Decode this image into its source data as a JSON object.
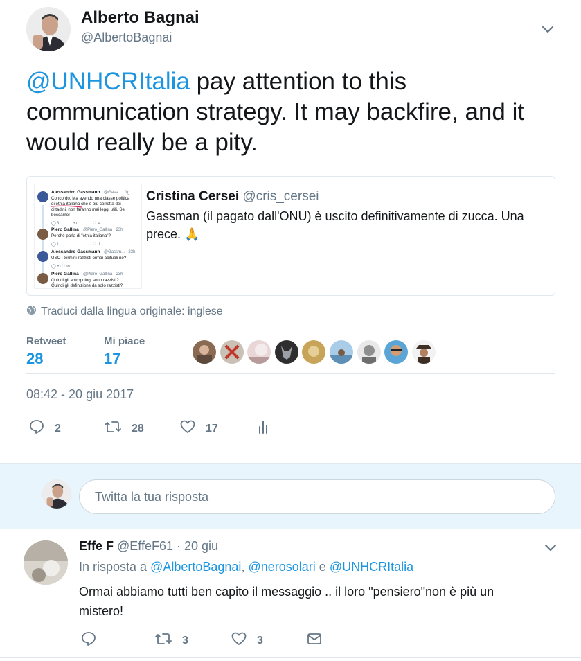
{
  "tweet": {
    "author_name": "Alberto Bagnai",
    "author_handle": "@AlbertoBagnai",
    "mention": "@UNHCRItalia",
    "text": " pay attention to this communication strategy. It may backfire, and it would really be a pity.",
    "menu_icon": "chevron-down-icon"
  },
  "quoted": {
    "name": "Cristina Cersei",
    "handle": "@cris_cersei",
    "text": "Gassman (il pagato dall'ONU) è uscito definitivamente di zucca. Una prece. 🙏",
    "thumbnail": {
      "rows": [
        {
          "name": "Alessandro Gassmann",
          "meta": "@Gass... · 1g",
          "lines": [
            "Concordo. Ma avendo una classe politica",
            "di etnia italiana che è più corrotta dei",
            "cittadini, non faranno mai leggi utili. Se",
            "beccamo!"
          ]
        },
        {
          "name": "Piero Gallina",
          "meta": "@Piero_Gallina · 23h",
          "lines": [
            "Perché parla di \"etnia italiana\"?"
          ]
        },
        {
          "name": "Alessandro Gassmann",
          "meta": "@Gassm... · 23h",
          "lines": [
            "USO i termini razzisti ormai abituali no?"
          ]
        },
        {
          "name": "Piero Gallina",
          "meta": "@Piero_Gallina · 23h",
          "lines": [
            "Quindi gli antropologi sono razzisti?",
            "Quindi gli definizione da solo razzisti?"
          ]
        }
      ],
      "counts": [
        "3",
        "4",
        "1",
        "1"
      ]
    }
  },
  "translate_label": "Traduci dalla lingua originale: inglese",
  "stats": {
    "retweet_label": "Retweet",
    "retweet_count": "28",
    "likes_label": "Mi piace",
    "likes_count": "17"
  },
  "timestamp": "08:42 - 20 giu 2017",
  "actions": {
    "replies": "2",
    "retweets": "28",
    "likes": "17"
  },
  "reply_box": {
    "placeholder": "Twitta la tua risposta"
  },
  "reply": {
    "name": "Effe F",
    "handle": "@EffeF61",
    "date": "20 giu",
    "in_reply_prefix": "In risposta a",
    "in_reply_mentions": [
      "@AlbertoBagnai",
      "@nerosolari",
      "@UNHCRItalia"
    ],
    "in_reply_sep": ",",
    "in_reply_and": "e",
    "text": "Ormai abbiamo tutti ben capito il messaggio .. il loro \"pensiero\"non è più un mistero!",
    "replies": "",
    "retweets": "3",
    "likes": "3"
  },
  "colors": {
    "accent": "#1b95e0",
    "muted": "#657786",
    "reply_band": "#e8f5fd"
  }
}
